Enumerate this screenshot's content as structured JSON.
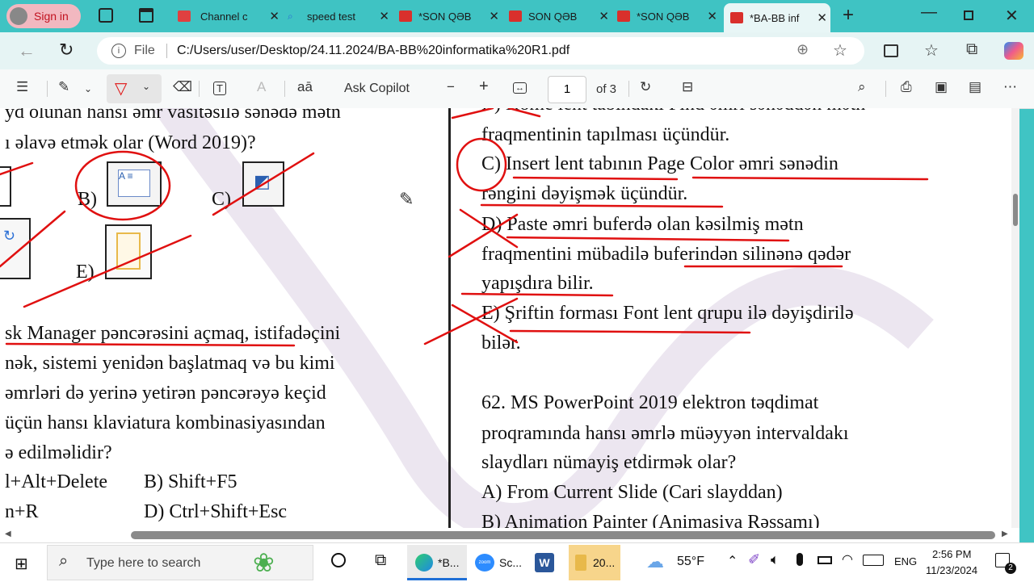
{
  "tabs": [
    {
      "label": "Sign in"
    },
    {
      "label": "Channel c"
    },
    {
      "label": "speed test"
    },
    {
      "label": "*SON QƏB"
    },
    {
      "label": "SON QƏB"
    },
    {
      "label": "*SON QƏB"
    },
    {
      "label": "*BA-BB inf"
    }
  ],
  "address": {
    "scheme": "File",
    "url": "C:/Users/user/Desktop/24.11.2024/BA-BB%20informatika%20R1.pdf"
  },
  "pdf_toolbar": {
    "ask_copilot": "Ask Copilot",
    "page": "1",
    "page_total": "of 3",
    "minus": "−",
    "plus": "+"
  },
  "left_page": {
    "lines": [
      "yd olunan hansı əmr vasitəsilə sənədə mətn",
      "ı əlavə etmək olar (Word 2019)?",
      "B)",
      "C)",
      "E)",
      "sk Manager pəncərəsini açmaq, istifadəçini",
      "nək, sistemi yenidən başlatmaq və bu kimi",
      "əmrləri də yerinə yetirən pəncərəyə keçid",
      "üçün hansı klaviatura kombinasiyasından",
      "ə edilməlidir?",
      "l+Alt+Delete",
      "B) Shift+F5",
      "n+R",
      "D) Ctrl+Shift+Esc"
    ]
  },
  "right_page": {
    "lines": [
      "B) Home lent tabındakı Find əmri sənəddən mətn",
      "fraqmentinin tapılması üçündür.",
      "C) Insert lent tabının Page Color əmri sənədin",
      "rəngini dəyişmək üçündür.",
      "D) Paste əmri buferdə olan kəsilmiş mətn",
      "fraqmentini mübadilə buferindən silinənə qədər",
      "yapışdıra bilir.",
      "E) Şriftin forması Font lent qrupu ilə dəyişdirilə",
      "bilər.",
      "62. MS PowerPoint 2019 elektron təqdimat",
      "proqramında hansı əmrlə müəyyən intervaldakı",
      "slaydları nümayiş etdirmək olar?",
      "A) From Current Slide (Cari slayddan)",
      "B) Animation Painter (Animasiya Rəssamı)"
    ]
  },
  "taskbar": {
    "search_placeholder": "Type here to search",
    "apps": [
      "*B...",
      "Sc...",
      "20..."
    ],
    "weather": "55°F",
    "lang": "ENG",
    "time": "2:56 PM",
    "date": "11/23/2024",
    "notif": "2"
  },
  "colors": {
    "accent": "#3fc3c3",
    "ink": "#e01010",
    "pdf_red": "#d9302c"
  }
}
